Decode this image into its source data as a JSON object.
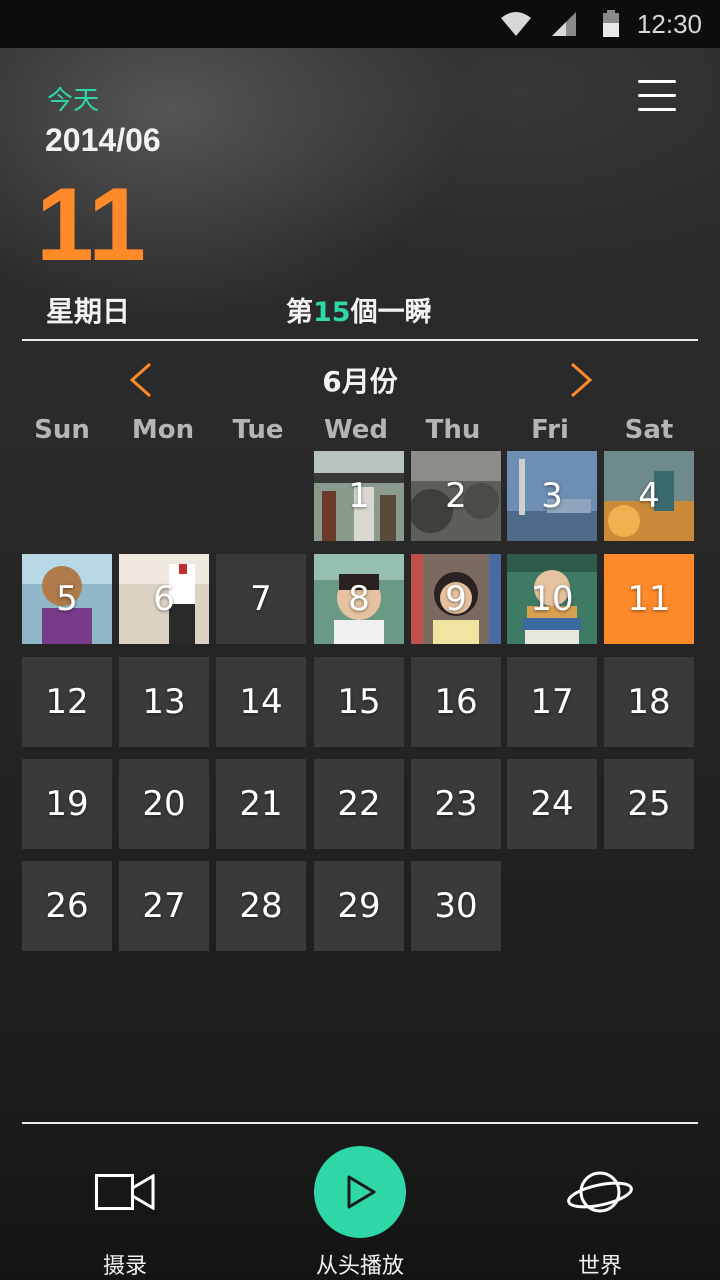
{
  "status_bar": {
    "time": "12:30"
  },
  "header": {
    "today_label": "今天",
    "date_ym": "2014/06",
    "day": "11",
    "weekday": "星期日",
    "moment_prefix": "第",
    "moment_count": "15",
    "moment_suffix": "個一瞬"
  },
  "calendar": {
    "month_title": "6月份",
    "weekdays": [
      "Sun",
      "Mon",
      "Tue",
      "Wed",
      "Thu",
      "Fri",
      "Sat"
    ],
    "days": [
      "1",
      "2",
      "3",
      "4",
      "5",
      "6",
      "7",
      "8",
      "9",
      "10",
      "11",
      "12",
      "13",
      "14",
      "15",
      "16",
      "17",
      "18",
      "19",
      "20",
      "21",
      "22",
      "23",
      "24",
      "25",
      "26",
      "27",
      "28",
      "29",
      "30"
    ],
    "selected_day": "11"
  },
  "bottom_nav": {
    "record_label": "摄录",
    "play_label": "从头播放",
    "world_label": "世界"
  },
  "colors": {
    "accent_green": "#2fd6a6",
    "accent_orange": "#ff8a2a"
  }
}
